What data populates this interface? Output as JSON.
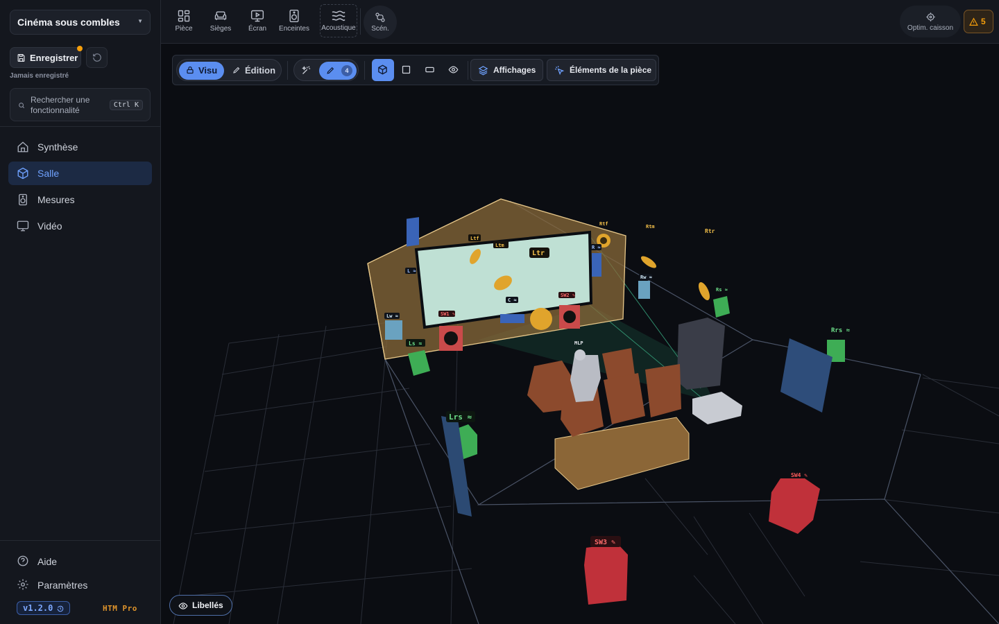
{
  "sidebar": {
    "project": "Cinéma sous combles",
    "save_label": "Enregistrer",
    "save_status": "Jamais enregistré",
    "search_placeholder": "Rechercher une fonctionnalité",
    "search_shortcut": "Ctrl K",
    "nav": [
      {
        "label": "Synthèse",
        "icon": "home-icon"
      },
      {
        "label": "Salle",
        "icon": "cube-icon",
        "active": true
      },
      {
        "label": "Mesures",
        "icon": "speaker-icon"
      },
      {
        "label": "Vidéo",
        "icon": "monitor-icon"
      }
    ],
    "help": "Aide",
    "settings": "Paramètres",
    "version": "v1.2.0",
    "plan": "HTM Pro"
  },
  "topbar": {
    "tabs": [
      "Pièce",
      "Sièges",
      "Écran",
      "Enceintes",
      "Acoustique",
      "Scén."
    ],
    "optim": "Optim. caisson",
    "warnings": "5"
  },
  "toolbar": {
    "view_label": "Visu",
    "edit_label": "Édition",
    "draw_count": "4",
    "displays_label": "Affichages",
    "elements_label": "Éléments de la pièce",
    "labels_toggle": "Libellés"
  },
  "scene": {
    "labels": {
      "Ltf": "Ltf",
      "Ltm": "Ltm",
      "Ltr": "Ltr",
      "Rtf": "Rtf",
      "Rtm": "Rtm",
      "Rtr": "Rtr",
      "L": "L ≈",
      "R": "R ≈",
      "Lw": "Lw ≈",
      "Rw": "Rw ≈",
      "C": "C ≈",
      "Ls": "Ls ≈",
      "Rs": "Rs ≈",
      "Lrs": "Lrs ≈",
      "Rrs": "Rrs ≈",
      "SW1": "SW1 ✎",
      "SW2": "SW2 ✎",
      "SW3": "SW3 ✎",
      "SW4": "SW4 ✎",
      "MLP": "MLP"
    },
    "colors": {
      "accent": "#5b8ef0",
      "warning": "#f59e0b",
      "subwoofer": "#c0313a",
      "surround": "#3ead55",
      "height": "#e0a42c"
    }
  }
}
